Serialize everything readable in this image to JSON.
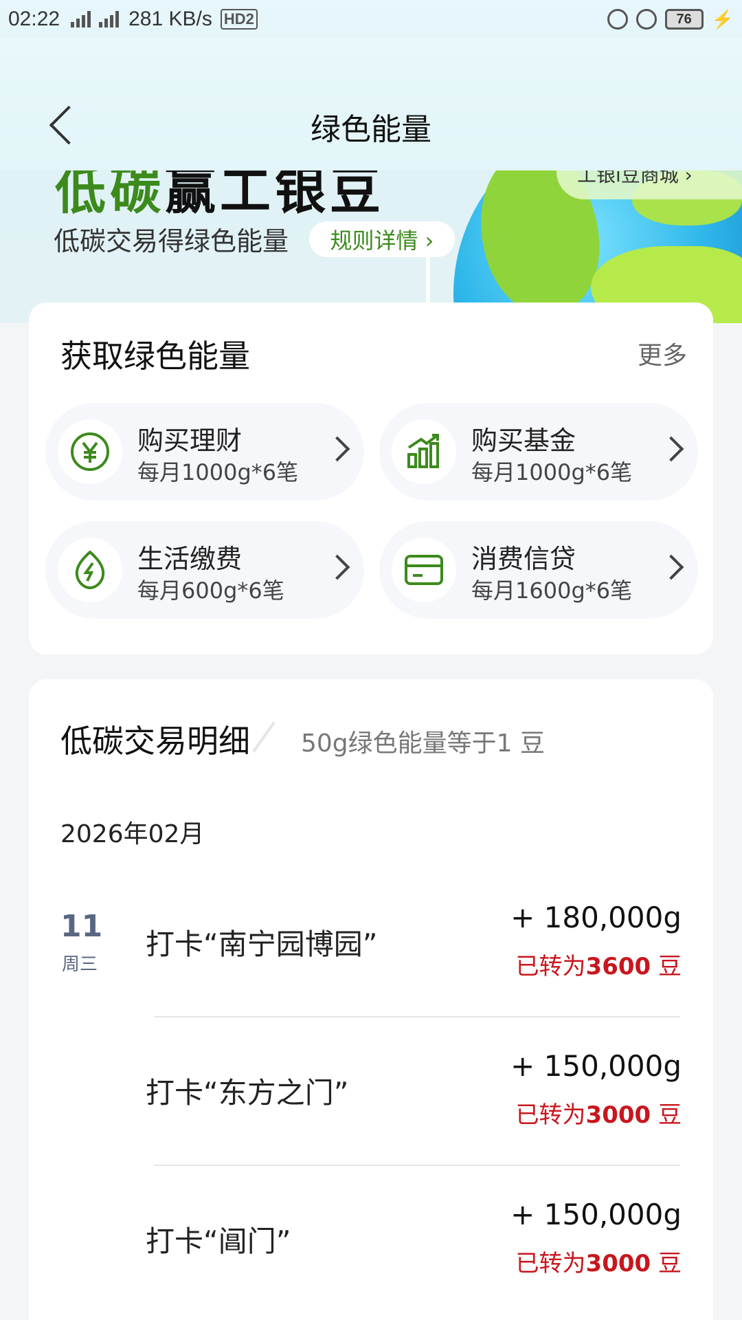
{
  "status_bar": {
    "time": "02:22",
    "network1": "4G",
    "network2": "4G",
    "speed": "281 KB/s",
    "hd": "HD2",
    "battery": "76"
  },
  "nav": {
    "title": "绿色能量"
  },
  "hero": {
    "big_title_green": "低碳",
    "big_title_black": "赢工银豆",
    "mall_label": "工银i豆商城 ›",
    "subtitle": "低碳交易得绿色能量",
    "rule_label": "规则详情 ›"
  },
  "tasks_card": {
    "title": "获取绿色能量",
    "more_label": "更多",
    "tasks": [
      {
        "name": "购买理财",
        "desc": "每月1000g*6笔",
        "icon": "yuan-icon"
      },
      {
        "name": "购买基金",
        "desc": "每月1000g*6笔",
        "icon": "chart-growth-icon"
      },
      {
        "name": "生活缴费",
        "desc": "每月600g*6笔",
        "icon": "energy-leaf-icon"
      },
      {
        "name": "消费信贷",
        "desc": "每月1600g*6笔",
        "icon": "credit-card-icon"
      }
    ]
  },
  "details_card": {
    "title": "低碳交易明细",
    "note": "50g绿色能量等于1 豆",
    "month": "2026年02月",
    "day": "11",
    "weekday": "周三",
    "rows": [
      {
        "title": "打卡“南宁园博园”",
        "amount": "+ 180,000g",
        "prefix": "已转为",
        "beans": "3600",
        "unit": " 豆"
      },
      {
        "title": "打卡“东方之门”",
        "amount": "+ 150,000g",
        "prefix": "已转为",
        "beans": "3000",
        "unit": " 豆"
      },
      {
        "title": "打卡“阊门”",
        "amount": "+ 150,000g",
        "prefix": "已转为",
        "beans": "3000",
        "unit": " 豆"
      }
    ]
  },
  "colors": {
    "accent_green": "#3c8a1c",
    "converted_red": "#c8161d",
    "date_slate": "#5a6782"
  }
}
